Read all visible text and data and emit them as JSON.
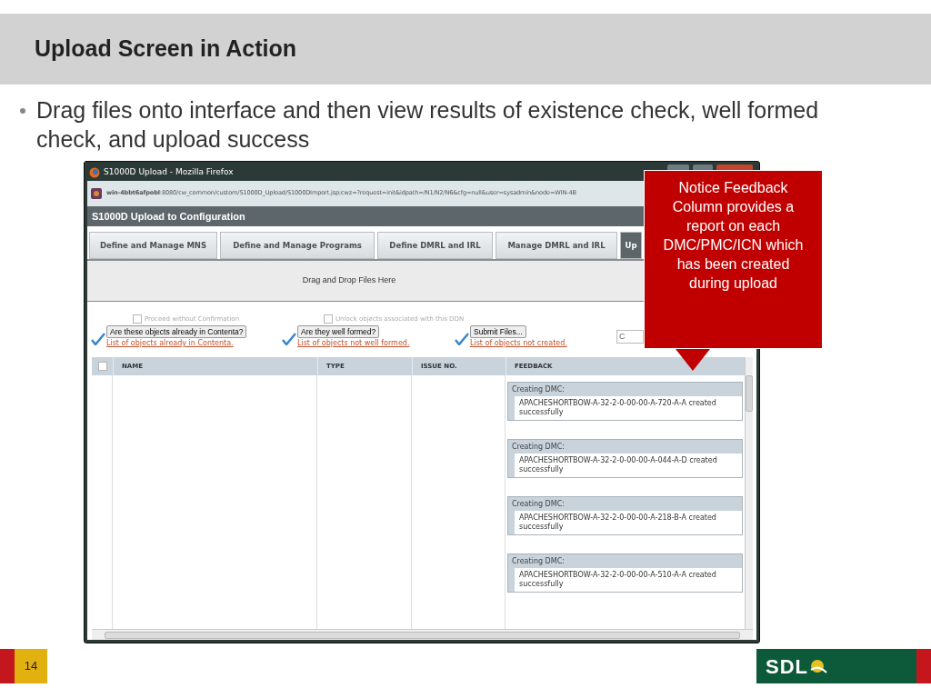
{
  "slide": {
    "title": "Upload Screen in Action",
    "bullets": [
      "Drag files onto interface and then view results of existence check, well formed check, and upload success"
    ],
    "page_number": "14",
    "logo": "SDL"
  },
  "browser": {
    "title": "S1000D Upload - Mozilla Firefox",
    "url": "**win-4bbt6afpobl**:8080/cw_common/custom/S1000D_Upload/S1000DImport.jsp;cwz=?request=init&idpath=/N1/N2/N6&cfg=null&user=sysadmin&node=WIN-4B"
  },
  "app": {
    "title": "S1000D Upload to Configuration",
    "tabs": [
      {
        "label": "Define and Manage MNS",
        "selected": false
      },
      {
        "label": "Define and Manage Programs",
        "selected": false
      },
      {
        "label": "Define DMRL and IRL",
        "selected": false
      },
      {
        "label": "Manage DMRL and IRL",
        "selected": false
      },
      {
        "label": "Up",
        "selected": true
      }
    ],
    "drop_zone": "Drag and Drop Files Here",
    "checks": [
      {
        "label": "Proceed without Confirmation",
        "checked": false
      },
      {
        "label": "Unlock objects associated with this DDN",
        "checked": false
      }
    ],
    "steps": [
      {
        "button": "Are these objects already in Contenta?",
        "link": "List of objects already in Contenta.",
        "done": true
      },
      {
        "button": "Are they well formed?",
        "link": "List of objects not well formed.",
        "done": true
      },
      {
        "button": "Submit Files...",
        "link": "List of objects not created.",
        "done": true
      }
    ],
    "cut_field": "C",
    "table": {
      "select_all": false,
      "columns": [
        "NAME",
        "TYPE",
        "ISSUE NO.",
        "FEEDBACK"
      ],
      "feedback": [
        {
          "heading": "Creating DMC:",
          "message": "APACHESHORTBOW-A-32-2-0-00-00-A-720-A-A created successfully"
        },
        {
          "heading": "Creating DMC:",
          "message": "APACHESHORTBOW-A-32-2-0-00-00-A-044-A-D created successfully"
        },
        {
          "heading": "Creating DMC:",
          "message": "APACHESHORTBOW-A-32-2-0-00-00-A-218-B-A created successfully"
        },
        {
          "heading": "Creating DMC:",
          "message": "APACHESHORTBOW-A-32-2-0-00-00-A-510-A-A created successfully"
        }
      ]
    }
  },
  "callout": "Notice Feedback Column provides a report on each DMC/PMC/ICN which has been created during upload"
}
